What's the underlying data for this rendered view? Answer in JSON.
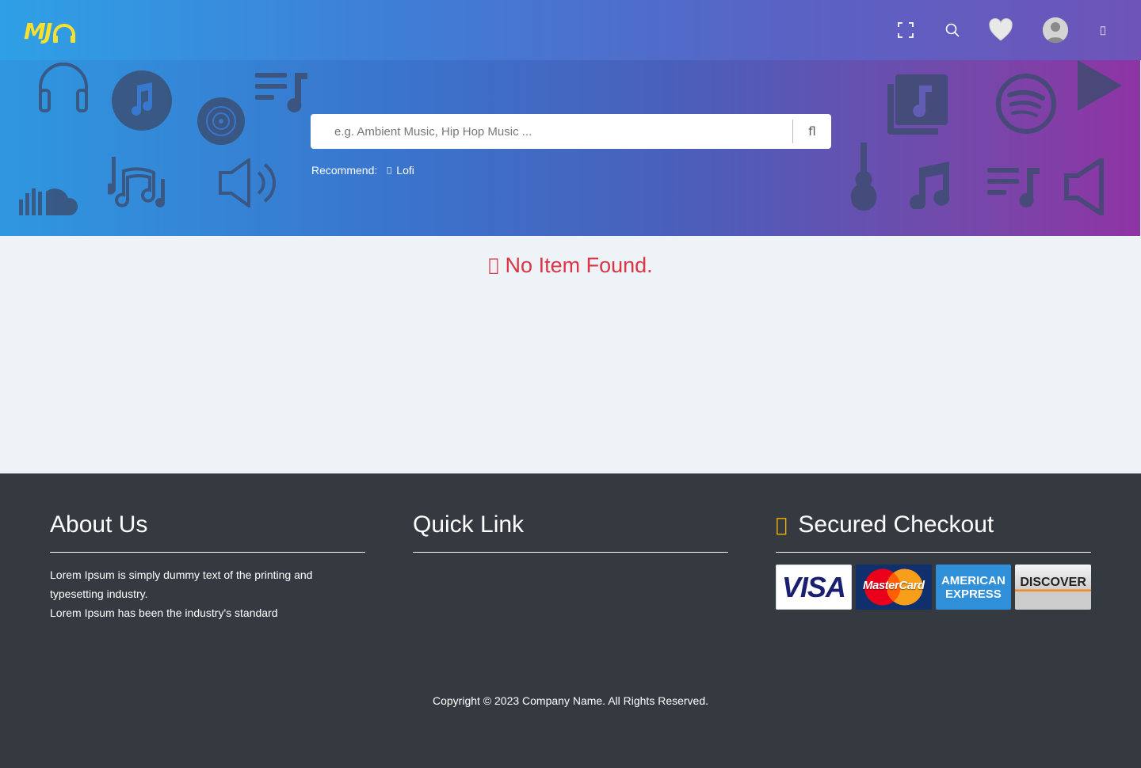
{
  "header": {
    "logo_text": "MJ",
    "icons": [
      "fullscreen-icon",
      "search-icon",
      "heart-icon",
      "avatar",
      "menu-icon"
    ],
    "menu_glyph": ""
  },
  "hero": {
    "search": {
      "placeholder": "e.g. Ambient Music, Hip Hop Music ...",
      "value": "",
      "button_glyph": "fl"
    },
    "recommend": {
      "label": "Recommend:",
      "tags": [
        {
          "label": "Lofi",
          "glyph": ""
        }
      ]
    }
  },
  "main": {
    "empty_glyph": "",
    "empty_message": "No Item Found."
  },
  "footer": {
    "about": {
      "title": "About Us",
      "lines": [
        "Lorem Ipsum is simply dummy text of the printing and typesetting industry.",
        "Lorem Ipsum has been the industry's standard"
      ]
    },
    "quick_link": {
      "title": "Quick Link"
    },
    "checkout": {
      "title": "Secured Checkout",
      "lock_glyph": "",
      "cards": [
        "VISA",
        "MasterCard",
        "AMERICAN",
        "EXPRESS",
        "DISCOVER"
      ]
    },
    "copyright": "Copyright © 2023  Company Name. All Rights Reserved."
  },
  "colors": {
    "accent_yellow": "#f7e12c",
    "error_red": "#dc3545",
    "footer_bg": "#353a41",
    "lock_yellow": "#f5b100"
  }
}
